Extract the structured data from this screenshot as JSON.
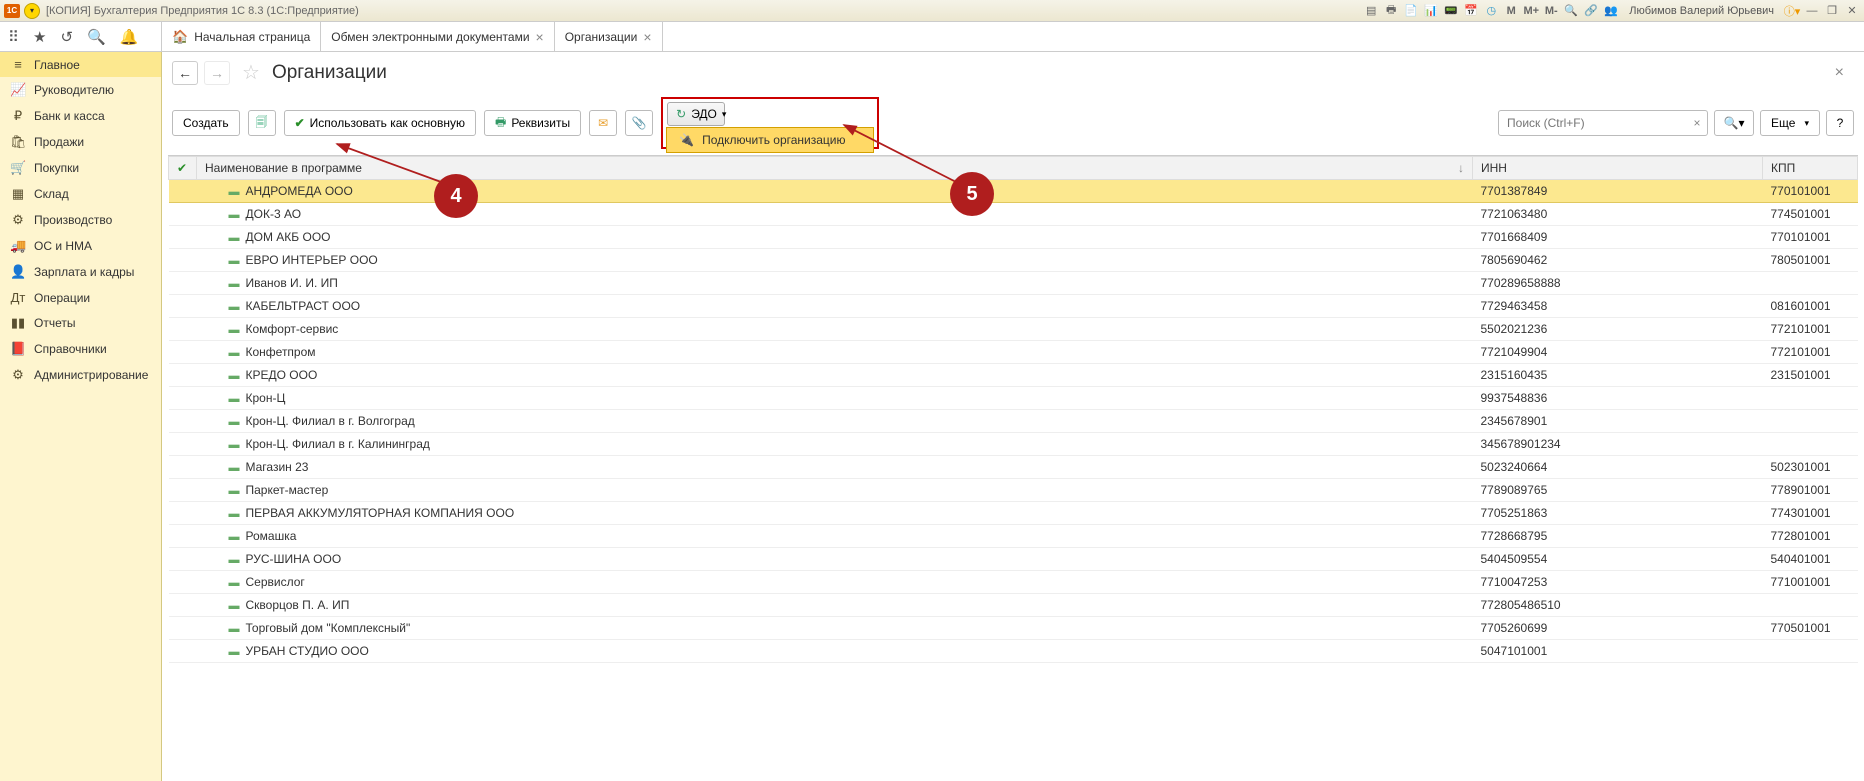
{
  "titlebar": {
    "app_label": "1С",
    "title": "[КОПИЯ] Бухгалтерия Предприятия 1С 8.3  (1С:Предприятие)",
    "user": "Любимов Валерий Юрьевич",
    "m_labels": [
      "M",
      "M+",
      "M-"
    ]
  },
  "tabs": [
    {
      "label": "Начальная страница",
      "closable": false,
      "home": true
    },
    {
      "label": "Обмен электронными документами",
      "closable": true
    },
    {
      "label": "Организации",
      "closable": true,
      "active": true
    }
  ],
  "sidebar": [
    {
      "icon": "≡",
      "label": "Главное",
      "active": true
    },
    {
      "icon": "📈",
      "label": "Руководителю"
    },
    {
      "icon": "₽",
      "label": "Банк и касса"
    },
    {
      "icon": "🛍",
      "label": "Продажи"
    },
    {
      "icon": "🛒",
      "label": "Покупки"
    },
    {
      "icon": "▦",
      "label": "Склад"
    },
    {
      "icon": "⚙",
      "label": "Производство"
    },
    {
      "icon": "🚚",
      "label": "ОС и НМА"
    },
    {
      "icon": "👤",
      "label": "Зарплата и кадры"
    },
    {
      "icon": "Дт",
      "label": "Операции"
    },
    {
      "icon": "▮▮",
      "label": "Отчеты"
    },
    {
      "icon": "📕",
      "label": "Справочники"
    },
    {
      "icon": "⚙",
      "label": "Администрирование"
    }
  ],
  "page": {
    "title": "Организации"
  },
  "toolbar": {
    "create": "Создать",
    "use_as_main": "Использовать как основную",
    "requisites": "Реквизиты",
    "edo": "ЭДО",
    "edo_menu": "Подключить организацию",
    "search_placeholder": "Поиск (Ctrl+F)",
    "more": "Еще"
  },
  "table": {
    "headers": {
      "name": "Наименование в программе",
      "inn": "ИНН",
      "kpp": "КПП"
    },
    "rows": [
      {
        "name": "АНДРОМЕДА ООО",
        "inn": "7701387849",
        "kpp": "770101001",
        "selected": true
      },
      {
        "name": "ДОК-3 АО",
        "inn": "7721063480",
        "kpp": "774501001"
      },
      {
        "name": "ДОМ АКБ ООО",
        "inn": "7701668409",
        "kpp": "770101001"
      },
      {
        "name": "ЕВРО ИНТЕРЬЕР ООО",
        "inn": "7805690462",
        "kpp": "780501001"
      },
      {
        "name": "Иванов И. И. ИП",
        "inn": "770289658888",
        "kpp": ""
      },
      {
        "name": "КАБЕЛЬТРАСТ ООО",
        "inn": "7729463458",
        "kpp": "081601001"
      },
      {
        "name": "Комфорт-сервис",
        "inn": "5502021236",
        "kpp": "772101001"
      },
      {
        "name": "Конфетпром",
        "inn": "7721049904",
        "kpp": "772101001"
      },
      {
        "name": "КРЕДО ООО",
        "inn": "2315160435",
        "kpp": "231501001"
      },
      {
        "name": "Крон-Ц",
        "inn": "9937548836",
        "kpp": ""
      },
      {
        "name": "Крон-Ц. Филиал в г. Волгоград",
        "inn": "2345678901",
        "kpp": ""
      },
      {
        "name": "Крон-Ц. Филиал в г. Калининград",
        "inn": "345678901234",
        "kpp": ""
      },
      {
        "name": "Магазин 23",
        "inn": "5023240664",
        "kpp": "502301001"
      },
      {
        "name": "Паркет-мастер",
        "inn": "7789089765",
        "kpp": "778901001"
      },
      {
        "name": "ПЕРВАЯ АККУМУЛЯТОРНАЯ КОМПАНИЯ ООО",
        "inn": "7705251863",
        "kpp": "774301001"
      },
      {
        "name": "Ромашка",
        "inn": "7728668795",
        "kpp": "772801001"
      },
      {
        "name": "РУС-ШИНА ООО",
        "inn": "5404509554",
        "kpp": "540401001"
      },
      {
        "name": "Сервислог",
        "inn": "7710047253",
        "kpp": "771001001"
      },
      {
        "name": "Скворцов П. А. ИП",
        "inn": "772805486510",
        "kpp": ""
      },
      {
        "name": "Торговый дом \"Комплексный\"",
        "inn": "7705260699",
        "kpp": "770501001"
      },
      {
        "name": "УРБАН СТУДИО ООО",
        "inn": "5047101001",
        "kpp": ""
      }
    ]
  },
  "annotations": {
    "label4": "4",
    "label5": "5"
  }
}
